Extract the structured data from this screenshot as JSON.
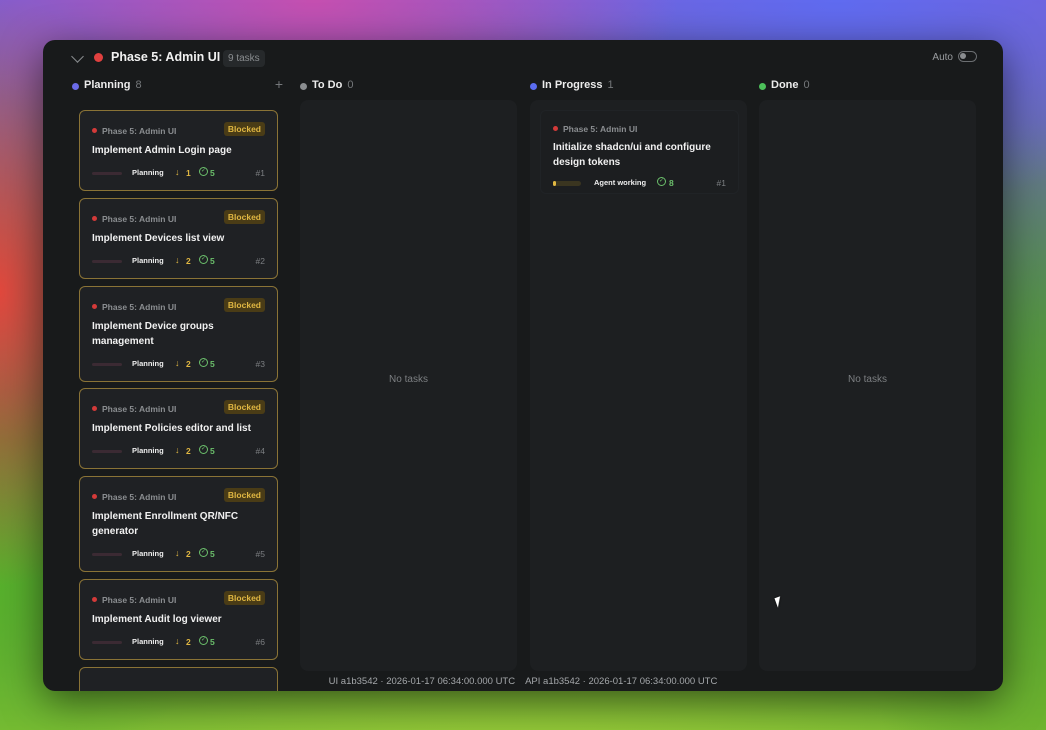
{
  "header": {
    "phase_title": "Phase 5: Admin UI",
    "task_count": "9 tasks",
    "auto_label": "Auto",
    "colors": {
      "phase_dot": "#e0403f"
    }
  },
  "columns": [
    {
      "title": "Planning",
      "count": "8",
      "dot_color": "#6b6be8",
      "add": "+"
    },
    {
      "title": "To Do",
      "count": "0",
      "dot_color": "#8a8d90",
      "empty_text": "No tasks"
    },
    {
      "title": "In Progress",
      "count": "1",
      "dot_color": "#5a6cf0"
    },
    {
      "title": "Done",
      "count": "0",
      "dot_color": "#4cc05a",
      "empty_text": "No tasks"
    }
  ],
  "planning_cards": [
    {
      "phase": "Phase 5: Admin UI",
      "badge": "Blocked",
      "title": "Implement Admin Login page",
      "status": "Planning",
      "deps": "1",
      "checks": "5",
      "num": "#1"
    },
    {
      "phase": "Phase 5: Admin UI",
      "badge": "Blocked",
      "title": "Implement Devices list view",
      "status": "Planning",
      "deps": "2",
      "checks": "5",
      "num": "#2"
    },
    {
      "phase": "Phase 5: Admin UI",
      "badge": "Blocked",
      "title": "Implement Device groups management",
      "status": "Planning",
      "deps": "2",
      "checks": "5",
      "num": "#3"
    },
    {
      "phase": "Phase 5: Admin UI",
      "badge": "Blocked",
      "title": "Implement Policies editor and list",
      "status": "Planning",
      "deps": "2",
      "checks": "5",
      "num": "#4"
    },
    {
      "phase": "Phase 5: Admin UI",
      "badge": "Blocked",
      "title": "Implement Enrollment QR/NFC generator",
      "status": "Planning",
      "deps": "2",
      "checks": "5",
      "num": "#5"
    },
    {
      "phase": "Phase 5: Admin UI",
      "badge": "Blocked",
      "title": "Implement Audit log viewer",
      "status": "Planning",
      "deps": "2",
      "checks": "5",
      "num": "#6"
    }
  ],
  "in_progress_cards": [
    {
      "phase": "Phase 5: Admin UI",
      "title": "Initialize shadcn/ui and configure design tokens",
      "status": "Agent working",
      "checks": "8",
      "num": "#1"
    }
  ],
  "footer": {
    "ui_version": "UI a1b3542 · 2026-01-17 06:34:00.000 UTC",
    "api_version": "API a1b3542 · 2026-01-17 06:34:00.000 UTC"
  }
}
